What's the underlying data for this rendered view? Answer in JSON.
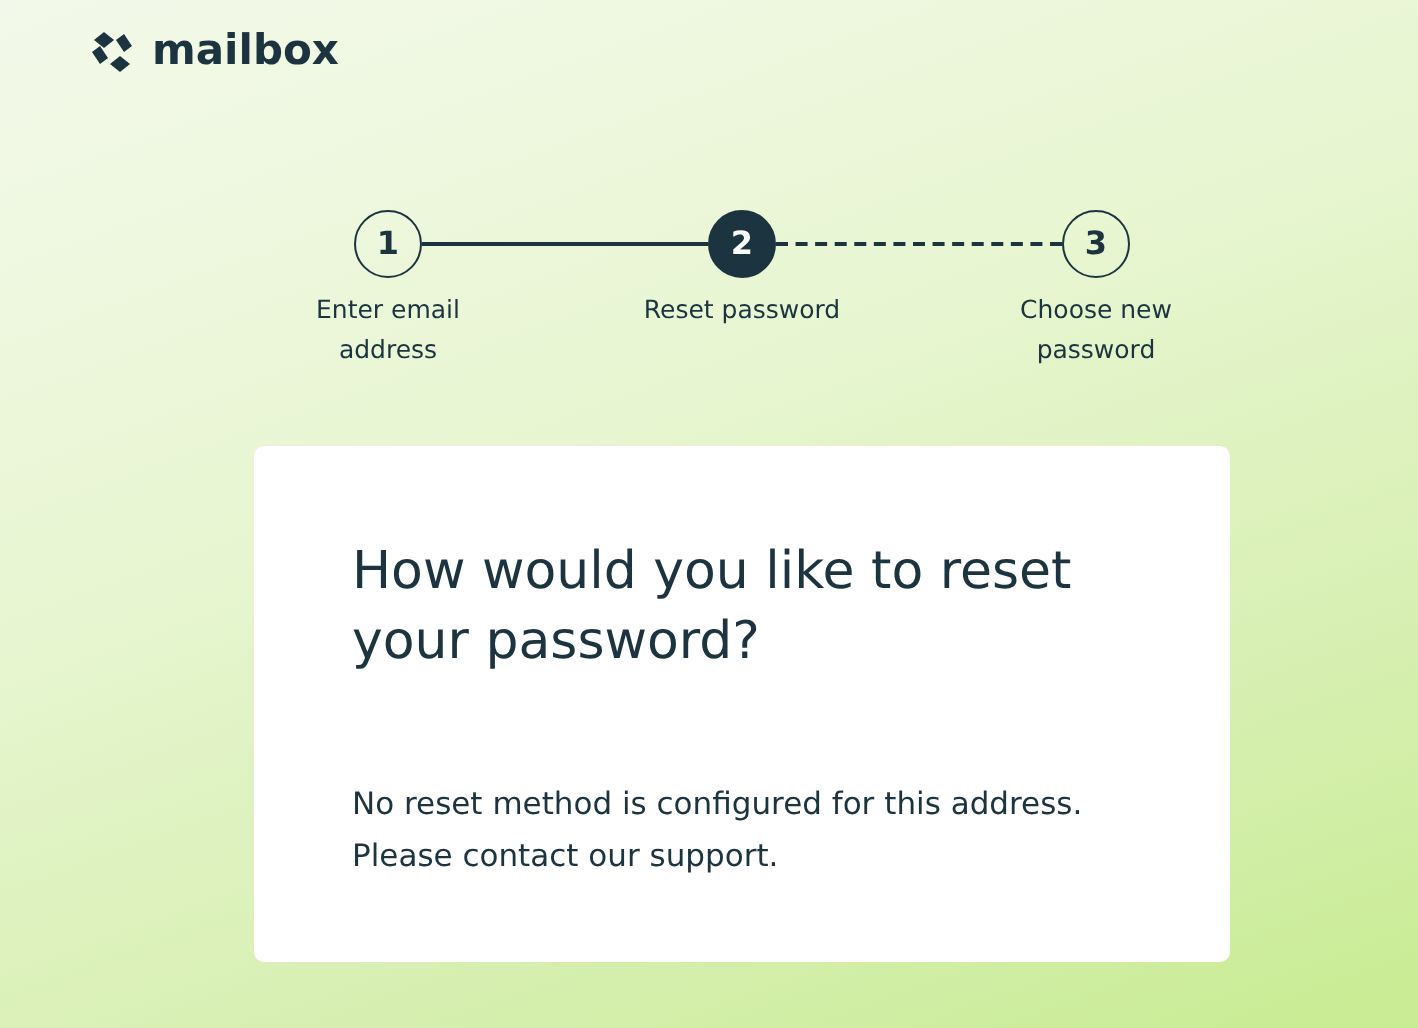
{
  "logo": {
    "text": "mailbox"
  },
  "steps": [
    {
      "number": "1",
      "label": "Enter email address",
      "selected": false
    },
    {
      "number": "2",
      "label": "Reset password",
      "selected": true
    },
    {
      "number": "3",
      "label": "Choose new password",
      "selected": false
    }
  ],
  "card": {
    "title": "How would you like to reset your password?",
    "message": "No reset method is configured for this address. Please contact our support."
  }
}
